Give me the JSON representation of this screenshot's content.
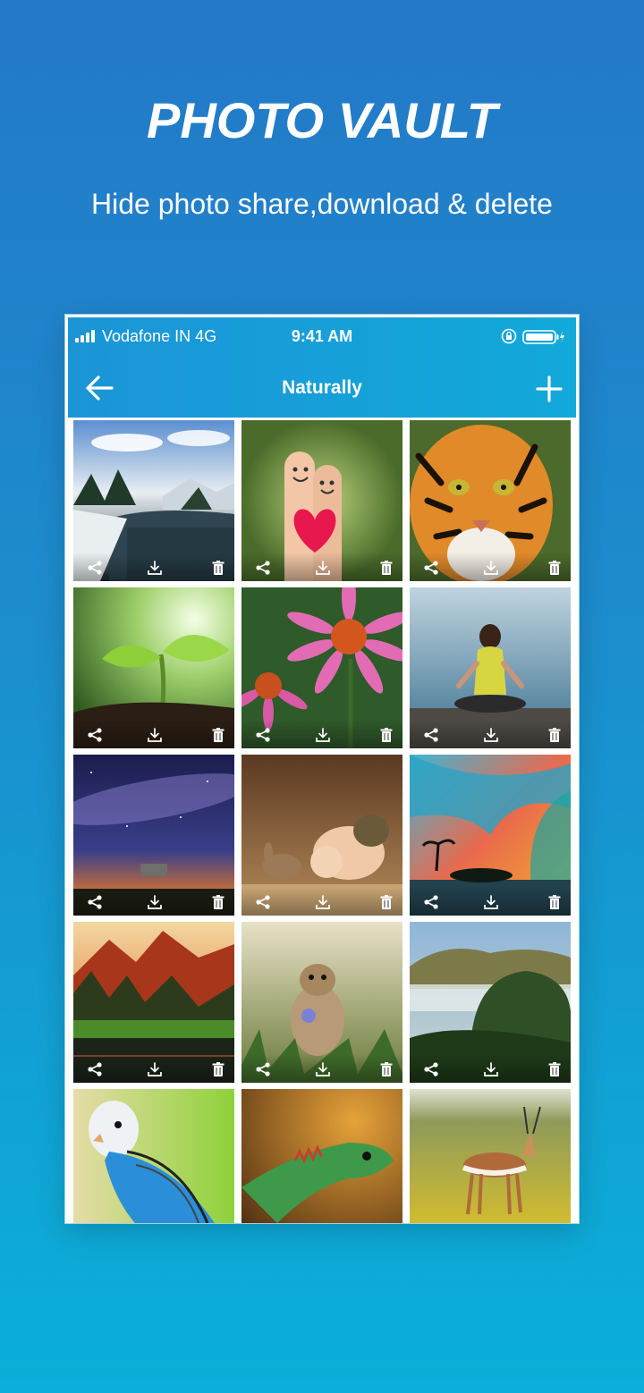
{
  "hero": {
    "title": "PHOTO VAULT",
    "subtitle": "Hide photo share,download & delete"
  },
  "status_bar": {
    "carrier": "Vodafone IN 4G",
    "time": "9:41 AM"
  },
  "app_bar": {
    "title": "Naturally",
    "back_icon": "arrow-left-icon",
    "add_icon": "plus-icon"
  },
  "gallery": {
    "photos": [
      "snowy river landscape",
      "smiling fingers holding heart",
      "tiger face",
      "green sprout in soil",
      "pink coneflowers",
      "woman meditating by lake",
      "milky way night sky",
      "baby and bunny",
      "colorful wave at sunset",
      "autumn mountains with lake",
      "chipmunk with flowers",
      "green hills in mist",
      "blue budgie parrot",
      "colorful iguana",
      "springbok in yellow field"
    ],
    "tile_actions": [
      "share-icon",
      "download-icon",
      "trash-icon"
    ]
  },
  "colors": {
    "background_top": "#2479c8",
    "background_bottom": "#0ab0d9",
    "app_bar": "#1b95d7",
    "text": "#ffffff"
  }
}
